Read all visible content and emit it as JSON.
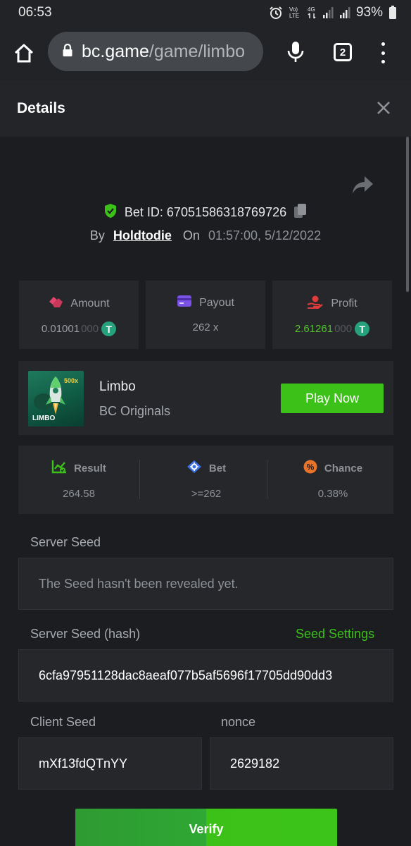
{
  "status_bar": {
    "time": "06:53",
    "battery": "93%",
    "network": "4G"
  },
  "browser": {
    "url_domain": "bc.game",
    "url_path": "/game/limbo",
    "tab_count": "2"
  },
  "dialog": {
    "title": "Details"
  },
  "bet": {
    "id_label": "Bet ID:",
    "id": "67051586318769726",
    "by_label": "By",
    "username": "Holdtodie",
    "on_label": "On",
    "date": "01:57:00, 5/12/2022"
  },
  "stats": {
    "amount": {
      "label": "Amount",
      "value": "0.01001",
      "value_dim": "000",
      "currency_icon": "T"
    },
    "payout": {
      "label": "Payout",
      "value": "262 x"
    },
    "profit": {
      "label": "Profit",
      "value": "2.61261",
      "value_dim": "000",
      "currency_icon": "T"
    }
  },
  "game": {
    "name": "Limbo",
    "provider": "BC Originals",
    "thumb_badge": "500x",
    "thumb_title": "LIMBO",
    "play_label": "Play Now"
  },
  "result": {
    "result_label": "Result",
    "result_value": "264.58",
    "bet_label": "Bet",
    "bet_value": ">=262",
    "chance_label": "Chance",
    "chance_value": "0.38%",
    "chance_icon": "%"
  },
  "seeds": {
    "server_seed_label": "Server Seed",
    "server_seed_value": "The Seed hasn't been revealed yet.",
    "server_seed_hash_label": "Server Seed (hash)",
    "seed_settings_label": "Seed Settings",
    "server_seed_hash_value": "6cfa97951128dac8aeaf077b5af5696f17705dd90dd3",
    "client_seed_label": "Client Seed",
    "client_seed_value": "mXf13fdQTnYY",
    "nonce_label": "nonce",
    "nonce_value": "2629182"
  },
  "verify_label": "Verify",
  "colors": {
    "accent_green": "#3bc117",
    "amount_icon": "#e2446b",
    "payout_icon": "#7b52e6",
    "profit_icon": "#e03b3b",
    "tether": "#26a17b"
  }
}
